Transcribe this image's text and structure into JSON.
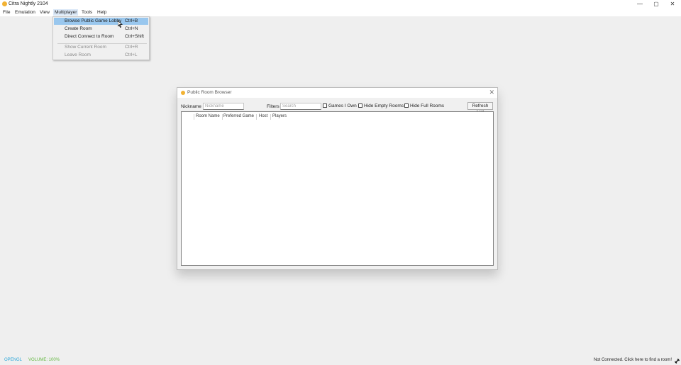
{
  "window": {
    "title": "Citra Nightly 2104",
    "minimize_glyph": "—",
    "maximize_glyph": "▢",
    "close_glyph": "✕",
    "icon": "citra-logo-icon"
  },
  "menubar": {
    "items": [
      "File",
      "Emulation",
      "View",
      "Multiplayer",
      "Tools",
      "Help"
    ]
  },
  "multiplayer_menu": {
    "items": [
      {
        "label": "Browse Public Game Lobby",
        "shortcut": "Ctrl+B"
      },
      {
        "label": "Create Room",
        "shortcut": "Ctrl+N"
      },
      {
        "label": "Direct Connect to Room",
        "shortcut": "Ctrl+Shift"
      },
      {
        "label": "Show Current Room",
        "shortcut": "Ctrl+R"
      },
      {
        "label": "Leave Room",
        "shortcut": "Ctrl+L"
      }
    ]
  },
  "dialog": {
    "title": "Public Room Browser",
    "close_glyph": "✕",
    "nickname_label": "Nickname",
    "nickname_placeholder": "Nickname",
    "filters_label": "Filters",
    "search_placeholder": "Search",
    "checkboxes": [
      "Games I Own",
      "Hide Empty Rooms",
      "Hide Full Rooms"
    ],
    "refresh_label": "Refresh List",
    "columns": [
      "Room Name",
      "Preferred Game",
      "Host",
      "Players"
    ]
  },
  "status": {
    "renderer": "OPENGL",
    "volume": "VOLUME: 100%",
    "connection": "Not Connected. Click here to find a room!",
    "renderer_color": "#2aa6d8",
    "volume_color": "#65b843"
  }
}
